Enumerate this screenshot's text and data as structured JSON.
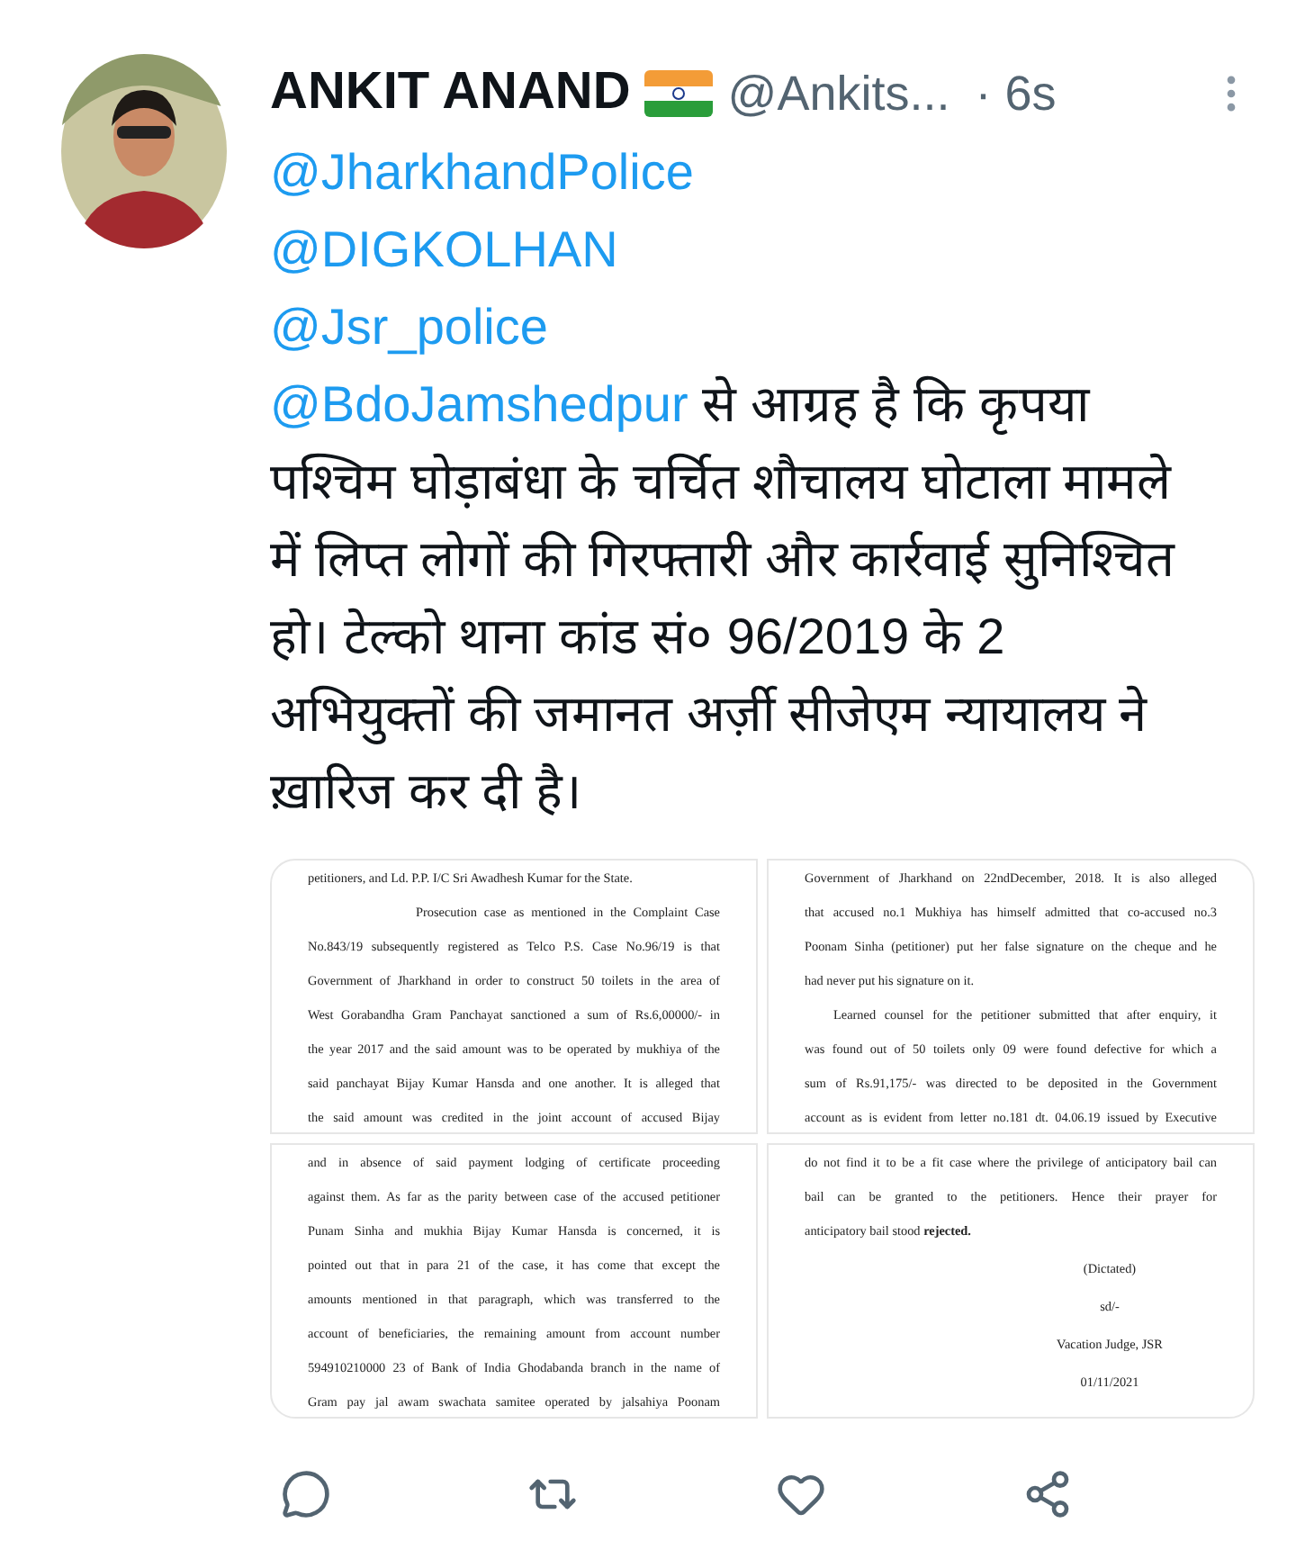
{
  "tweet": {
    "author": {
      "name": "ANKIT ANAND",
      "handle": "@Ankits...",
      "time": "· 6s"
    },
    "mentions": [
      "@JharkhandPolice",
      "@DIGKOLHAN",
      "@Jsr_police"
    ],
    "text": {
      "mention": "@BdoJamshedpur",
      "body": "से आग्रह है कि कृपया पश्चिम घोड़ाबंधा के चर्चित शौचालय घोटाला मामले में लिप्त लोगों की गिरफ्तारी और कार्रवाई सुनिश्चित हो। टेल्को थाना कांड सं० 96/2019 के 2 अभियुक्तों की जमानत अर्ज़ी सीजेएम न्यायालय ने ख़ारिज कर दी है।"
    },
    "documents": [
      {
        "lines": [
          {
            "kind": "left",
            "text": "petitioners,  and Ld.  P.P. I/C Sri Awadhesh Kumar for the State."
          },
          {
            "kind": "indent",
            "text": "Prosecution case as mentioned in the Complaint Case"
          },
          {
            "kind": "justify",
            "text": "No.843/19 subsequently registered as Telco P.S. Case No.96/19 is that"
          },
          {
            "kind": "justify",
            "text": "Government of Jharkhand in order to construct 50 toilets in the area of"
          },
          {
            "kind": "justify",
            "text": "West Gorabandha Gram Panchayat sanctioned a sum of Rs.6,00000/- in"
          },
          {
            "kind": "justify",
            "text": "the year 2017 and the said amount was to be operated by mukhiya of the"
          },
          {
            "kind": "justify",
            "text": "said panchayat Bijay Kumar Hansda  and one another. It is alleged that"
          },
          {
            "kind": "justify",
            "text": "the said amount was credited in the joint account of accused Bijay"
          }
        ]
      },
      {
        "lines": [
          {
            "kind": "justify",
            "text": "Government of Jharkhand on 22ndDecember, 2018. It is also alleged"
          },
          {
            "kind": "justify",
            "text": "that accused no.1 Mukhiya has himself admitted that co-accused no.3"
          },
          {
            "kind": "justify",
            "text": "Poonam Sinha (petitioner) put her false signature on the cheque and he"
          },
          {
            "kind": "left",
            "text": "had never put his signature on it."
          },
          {
            "kind": "para",
            "text": "Learned counsel for the petitioner submitted that after enquiry, it"
          },
          {
            "kind": "justify",
            "text": "was found out of 50 toilets only 09 were found defective for which a"
          },
          {
            "kind": "justify",
            "text": "sum of Rs.91,175/- was directed to be deposited in the Government"
          },
          {
            "kind": "justify",
            "text": "account as is evident from letter no.181 dt. 04.06.19 issued by Executive"
          }
        ]
      },
      {
        "lines": [
          {
            "kind": "justify",
            "text": "and in absence of said  payment  lodging of certificate proceeding"
          },
          {
            "kind": "justify",
            "text": "against them.  As far as the parity between case of the accused petitioner"
          },
          {
            "kind": "justify",
            "text": "Punam Sinha   and mukhia Bijay Kumar Hansda is concerned, it is"
          },
          {
            "kind": "justify",
            "text": "pointed out that in para 21 of the case, it has come that  except  the"
          },
          {
            "kind": "justify",
            "text": "amounts  mentioned in that paragraph, which was transferred to the"
          },
          {
            "kind": "justify",
            "text": "account of beneficiaries, the remaining amount from account number"
          },
          {
            "kind": "justify",
            "text": "594910210000 23 of Bank of India Ghodabanda branch in the name of"
          },
          {
            "kind": "justify",
            "text": "Gram pay jal awam swachata samitee operated by jalsahiya Poonam"
          }
        ]
      },
      {
        "lines": [
          {
            "kind": "justify",
            "text": "do not find it to be a fit case where the privilege of anticipatory bail can"
          },
          {
            "kind": "justify",
            "text": "bail can be granted to the petitioners.  Hence their prayer for"
          },
          {
            "kind": "left",
            "text": "anticipatory bail stood **rejected.**"
          },
          {
            "kind": "center",
            "text": "(Dictated)"
          },
          {
            "kind": "center",
            "text": "sd/-"
          },
          {
            "kind": "center",
            "text": "Vacation Judge, JSR"
          },
          {
            "kind": "center",
            "text": "01/11/2021"
          }
        ]
      }
    ]
  }
}
